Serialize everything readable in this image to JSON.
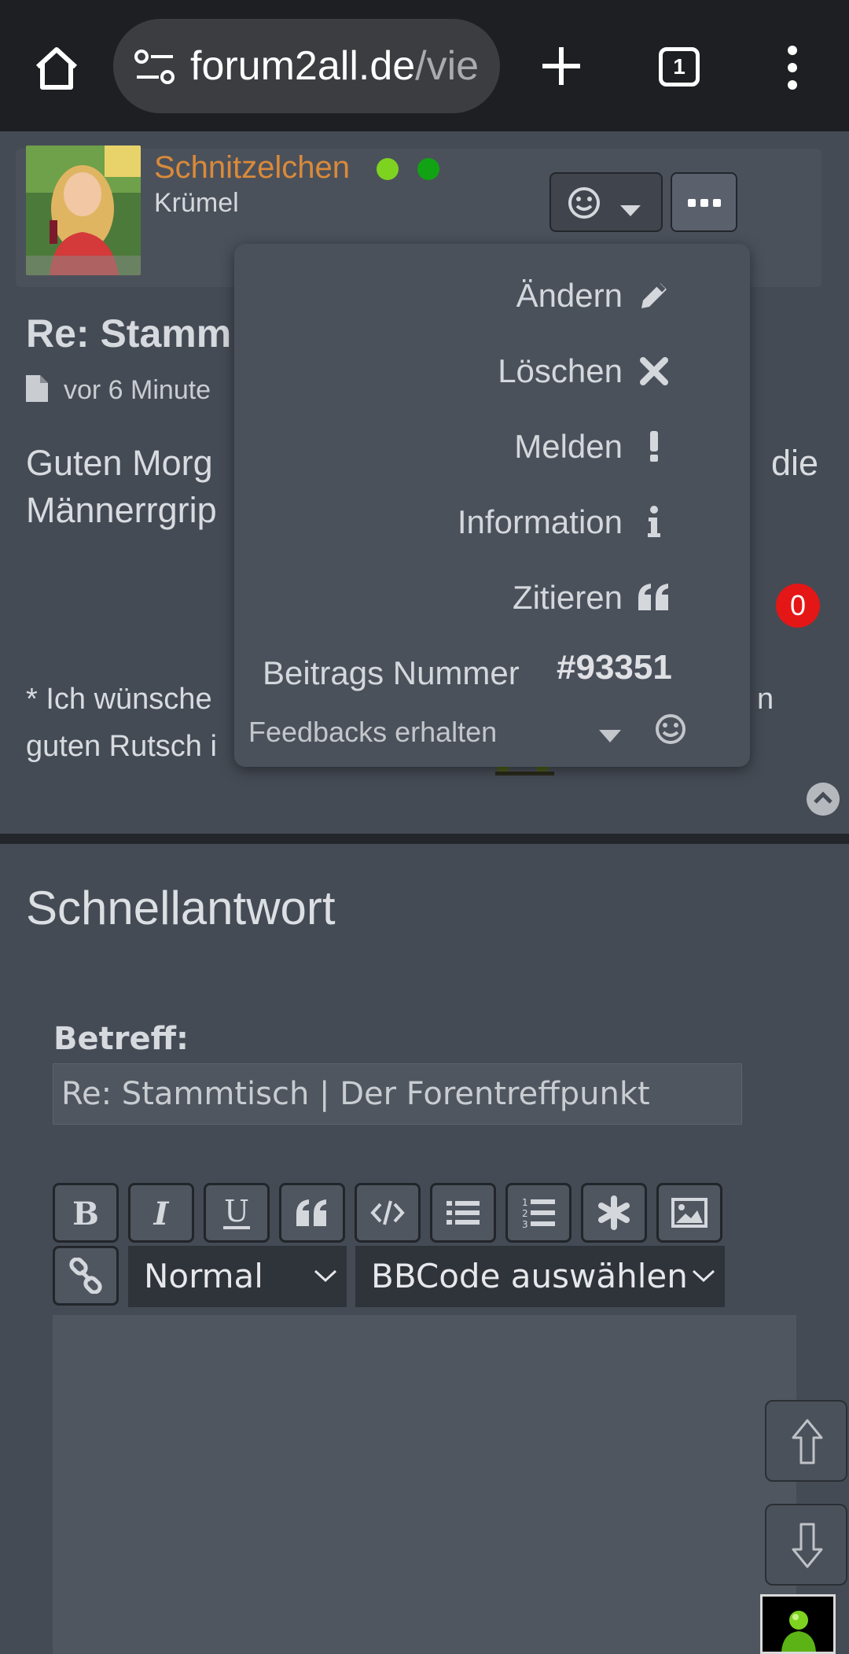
{
  "browser": {
    "url_host": "forum2all.de",
    "url_path": "/vie",
    "tab_count": "1"
  },
  "post": {
    "username": "Schnitzelchen",
    "user_rank": "Krümel",
    "title": "Re: Stamm",
    "meta_time": "vor 6 Minute",
    "body_line1": "Guten Morg",
    "body_line1_right": "die",
    "body_line2": "Männerrgrip",
    "reaction_count": "0",
    "sig_line1": "* Ich wünsche",
    "sig_line1_right": "n",
    "sig_line2": "guten Rutsch i"
  },
  "dropdown": {
    "items": [
      {
        "label": "Ändern",
        "icon": "pencil-icon"
      },
      {
        "label": "Löschen",
        "icon": "times-icon"
      },
      {
        "label": "Melden",
        "icon": "exclamation-icon"
      },
      {
        "label": "Information",
        "icon": "info-icon"
      },
      {
        "label": "Zitieren",
        "icon": "quote-icon"
      }
    ],
    "post_number_label": "Beitrags Nummer",
    "post_number": "#93351",
    "feedback_label": "Feedbacks erhalten"
  },
  "quick_reply": {
    "title": "Schnellantwort",
    "subject_label": "Betreff:",
    "subject_value": "Re: Stammtisch | Der Forentreffpunkt",
    "font_size_select": "Normal",
    "bbcode_select": "BBCode auswählen",
    "toolbar_icons": [
      "bold-icon",
      "italic-icon",
      "underline-icon",
      "quote-icon",
      "code-icon",
      "list-icon",
      "ordered-list-icon",
      "asterisk-icon",
      "image-icon",
      "link-icon"
    ]
  },
  "colors": {
    "username": "#d98a3a",
    "online_dot_1": "#7ed321",
    "online_dot_2": "#11a314",
    "badge": "#e51616",
    "page_bg": "#454b55"
  }
}
